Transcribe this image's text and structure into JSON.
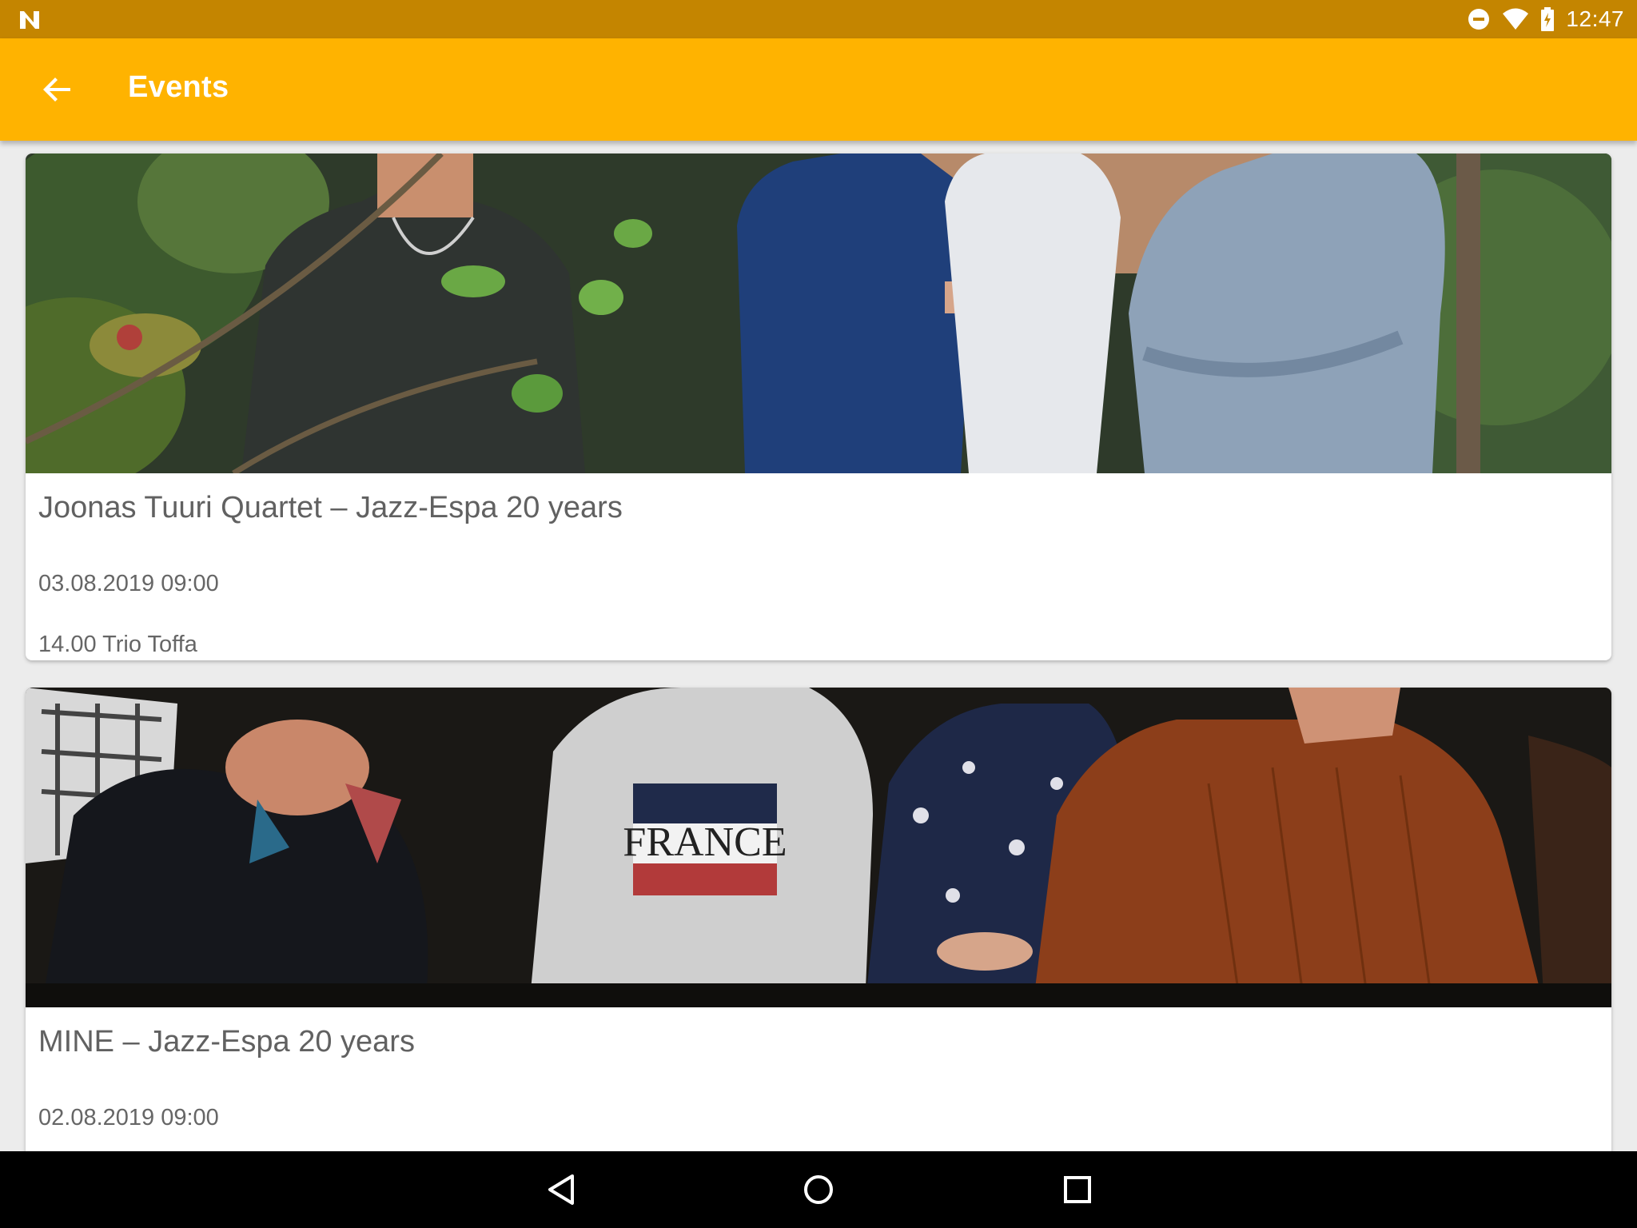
{
  "status_bar": {
    "time": "12:47",
    "icons": [
      "notification-n-icon",
      "do-not-disturb-icon",
      "wifi-icon",
      "battery-charging-icon"
    ]
  },
  "app_bar": {
    "back_icon": "arrow-back-icon",
    "title": "Events",
    "background": "#ffb300"
  },
  "events": [
    {
      "image": "band-photo-garden",
      "title": "Joonas Tuuri Quartet – Jazz-Espa 20 years",
      "date": "03.08.2019 09:00",
      "description": "14.00 Trio Toffa"
    },
    {
      "image": "band-photo-sofa",
      "image_text": "FRANCE",
      "title": "MINE – Jazz-Espa 20 years",
      "date": "02.08.2019 09:00"
    }
  ],
  "nav_bar": {
    "buttons": [
      "nav-back-icon",
      "nav-home-icon",
      "nav-recents-icon"
    ]
  }
}
